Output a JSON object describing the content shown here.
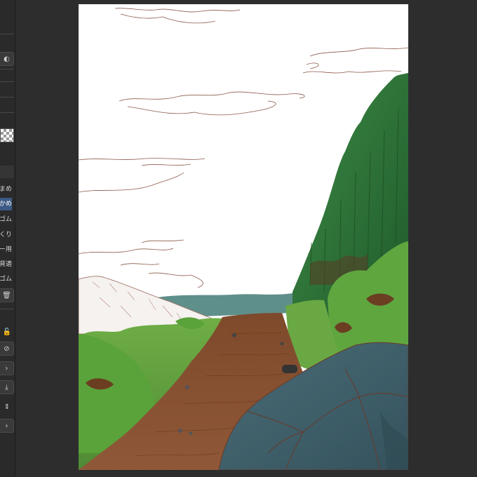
{
  "window": {
    "background": "#2d2d2d"
  },
  "sidebar": {
    "tool_labels": [
      "まめ",
      "かめ",
      "ゴム",
      "くり",
      "ー用",
      "背適",
      "ゴム"
    ],
    "active_index": 1,
    "icons": {
      "top": "color-wheel-icon",
      "transparency": "transparency-icon",
      "delete": "trash-icon",
      "lock": "lock-icon",
      "hide": "no-entry-icon",
      "next": "chevron-right-icon",
      "download": "download-icon",
      "updown": "up-down-icon",
      "next2": "chevron-right-icon"
    },
    "glyphs": {
      "color": "◐",
      "delete": "🗑",
      "lock": "🔓",
      "hide": "⊘",
      "next": "›",
      "download": "⤓",
      "updown": "⇕"
    }
  },
  "canvas": {
    "description_colors": {
      "path": "#8a5534",
      "grass": "#6aa43e",
      "forest": "#2f6f35",
      "rock": "#3f5f6a",
      "sea": "#5d8d88"
    }
  }
}
